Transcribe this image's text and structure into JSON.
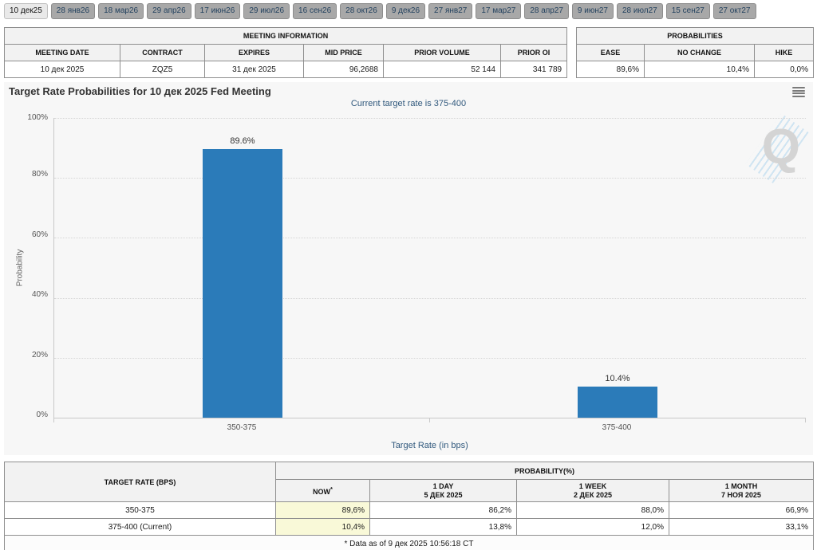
{
  "tabs": {
    "items": [
      "10 дек25",
      "28 янв26",
      "18 мар26",
      "29 апр26",
      "17 июн26",
      "29 июл26",
      "16 сен26",
      "28 окт26",
      "9 дек26",
      "27 янв27",
      "17 мар27",
      "28 апр27",
      "9 июн27",
      "28 июл27",
      "15 сен27",
      "27 окт27"
    ],
    "active": "10 дек25"
  },
  "meeting_info": {
    "title": "MEETING INFORMATION",
    "columns": [
      "MEETING DATE",
      "CONTRACT",
      "EXPIRES",
      "MID PRICE",
      "PRIOR VOLUME",
      "PRIOR OI"
    ],
    "row": [
      "10 дек 2025",
      "ZQZ5",
      "31 дек 2025",
      "96,2688",
      "52 144",
      "341 789"
    ]
  },
  "probabilities": {
    "title": "PROBABILITIES",
    "columns": [
      "EASE",
      "NO CHANGE",
      "HIKE"
    ],
    "row": [
      "89,6%",
      "10,4%",
      "0,0%"
    ]
  },
  "chart": {
    "title": "Target Rate Probabilities for 10 дек 2025 Fed Meeting",
    "subtitle": "Current target rate is 375-400",
    "ylabel": "Probability",
    "xlabel": "Target Rate (in bps)",
    "yticks": [
      "0%",
      "20%",
      "40%",
      "60%",
      "80%",
      "100%"
    ],
    "watermark": "Q",
    "bar_color": "#2b7bb9"
  },
  "chart_data": {
    "type": "bar",
    "title": "Target Rate Probabilities for 10 дек 2025 Fed Meeting",
    "subtitle": "Current target rate is 375-400",
    "categories": [
      "350-375",
      "375-400"
    ],
    "values": [
      89.6,
      10.4
    ],
    "labels": [
      "89.6%",
      "10.4%"
    ],
    "xlabel": "Target Rate (in bps)",
    "ylabel": "Probability",
    "ylim": [
      0,
      100
    ],
    "grid": "dotted-horizontal",
    "legend": "none"
  },
  "bottom_table": {
    "header_rate": "TARGET RATE (BPS)",
    "header_group": "PROBABILITY(%)",
    "sub_headers": {
      "now": "NOW",
      "now_sup": "*",
      "day1_l1": "1 DAY",
      "day1_l2": "5 ДЕК 2025",
      "week1_l1": "1 WEEK",
      "week1_l2": "2 ДЕК 2025",
      "month1_l1": "1 MONTH",
      "month1_l2": "7 НОЯ 2025"
    },
    "rows": [
      {
        "rate": "350-375",
        "now": "89,6%",
        "day": "86,2%",
        "week": "88,0%",
        "month": "66,9%"
      },
      {
        "rate": "375-400 (Current)",
        "now": "10,4%",
        "day": "13,8%",
        "week": "12,0%",
        "month": "33,1%"
      }
    ],
    "footnote": "* Data as of 9 дек 2025 10:56:18 CT"
  }
}
